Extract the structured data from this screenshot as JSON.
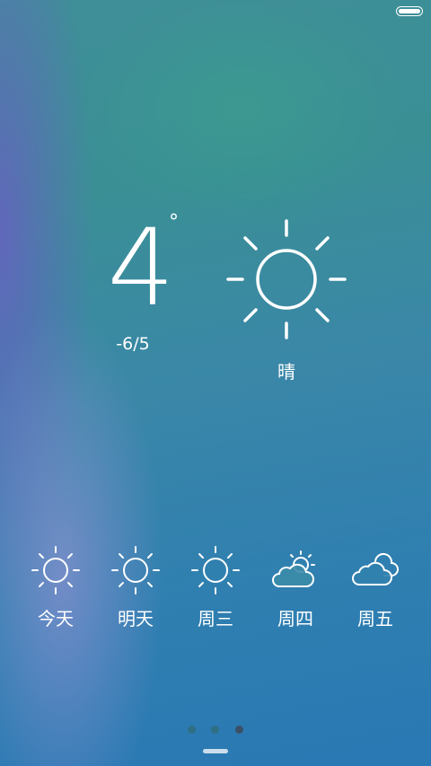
{
  "status_bar": {
    "battery_level": 1.0
  },
  "current": {
    "temperature": "4",
    "degree_symbol": "°",
    "range": "-6/5",
    "condition": "晴",
    "icon": "sun-icon"
  },
  "forecast": [
    {
      "label": "今天",
      "icon": "sun-icon"
    },
    {
      "label": "明天",
      "icon": "sun-icon"
    },
    {
      "label": "周三",
      "icon": "sun-icon"
    },
    {
      "label": "周四",
      "icon": "partly-cloudy-icon"
    },
    {
      "label": "周五",
      "icon": "cloudy-icon"
    }
  ],
  "pager": {
    "page_count": 3,
    "active_page": 3
  },
  "colors": {
    "dot_inactive": "#2f6f86",
    "dot_active": "#3b4f66"
  }
}
